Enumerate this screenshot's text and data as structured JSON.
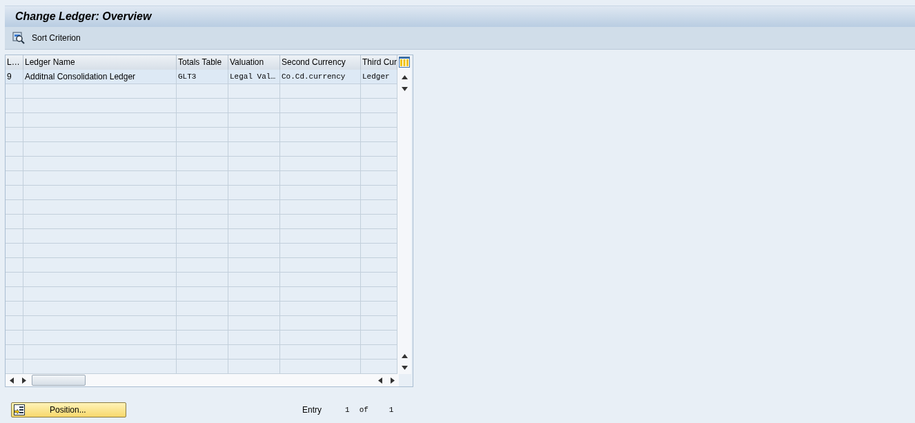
{
  "window": {
    "title": "Change Ledger: Overview"
  },
  "toolbar": [
    {
      "label": "Sort Criterion"
    }
  ],
  "table": {
    "columns": [
      "L…",
      "Ledger Name",
      "Totals Table",
      "Valuation",
      "Second Currency",
      "Third Cur"
    ],
    "rows": [
      [
        "9",
        "Additnal Consolidation Ledger",
        "GLT3",
        "Legal Val…",
        "Co.Cd.currency",
        "Ledger"
      ]
    ]
  },
  "footer": {
    "button": "Position...",
    "entry_label": "Entry",
    "entry_index": "1",
    "of_label": "of",
    "entry_total": "1"
  }
}
